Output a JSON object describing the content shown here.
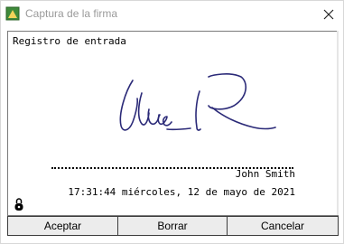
{
  "window": {
    "title": "Captura de la firma",
    "icon": "app-icon",
    "close_icon": "close-icon"
  },
  "pad": {
    "label": "Registro de entrada",
    "signer_name": "John Smith",
    "timestamp": "17:31:44 miércoles, 12 de mayo de 2021",
    "lock_icon": "lock-icon",
    "ink_color": "#2b2a78"
  },
  "buttons": {
    "accept": "Aceptar",
    "clear": "Borrar",
    "cancel": "Cancelar"
  }
}
